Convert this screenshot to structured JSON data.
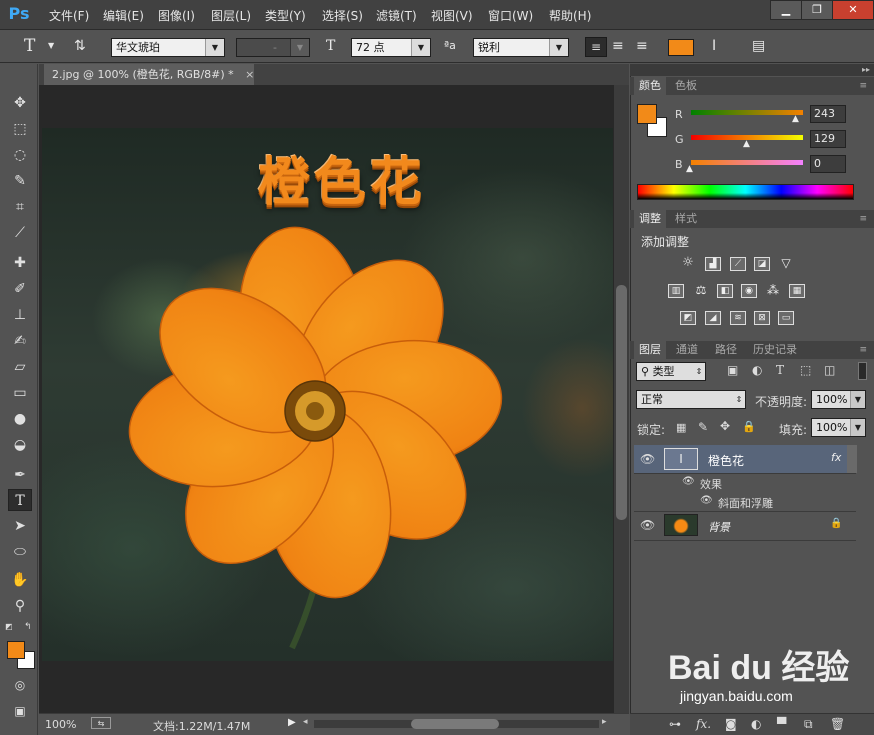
{
  "app": {
    "logo": "Ps"
  },
  "menu": [
    "文件(F)",
    "编辑(E)",
    "图像(I)",
    "图层(L)",
    "类型(Y)",
    "选择(S)",
    "滤镜(T)",
    "视图(V)",
    "窗口(W)",
    "帮助(H)"
  ],
  "window_controls": {
    "minimize": "▁",
    "restore": "❐",
    "close": "✕"
  },
  "options": {
    "tool_glyph": "T",
    "font_family": "华文琥珀",
    "font_style": "-",
    "font_size": "72 点",
    "aa_label": "ªa",
    "anti_alias": "锐利",
    "text_color": "#f28a18"
  },
  "document": {
    "tab_title": "2.jpg @ 100% (橙色花, RGB/8#) *",
    "close_glyph": "×",
    "canvas_text": "橙色花"
  },
  "status": {
    "zoom": "100%",
    "doc_info": "文档:1.22M/1.47M"
  },
  "colors_panel": {
    "tabs": [
      "颜色",
      "色板"
    ],
    "foreground": "#f28a18",
    "background": "#ffffff",
    "channels": [
      {
        "label": "R",
        "value": "243"
      },
      {
        "label": "G",
        "value": "129"
      },
      {
        "label": "B",
        "value": "0"
      }
    ]
  },
  "adjustments_panel": {
    "tabs": [
      "调整",
      "样式"
    ],
    "title": "添加调整"
  },
  "layers_panel": {
    "tabs": [
      "图层",
      "通道",
      "路径",
      "历史记录"
    ],
    "filter_kind": "类型",
    "blend_mode": "正常",
    "opacity_label": "不透明度:",
    "opacity_value": "100%",
    "lock_label": "锁定:",
    "fill_label": "填充:",
    "fill_value": "100%",
    "layers": [
      {
        "name": "橙色花",
        "fx": "fx",
        "effects_label": "效果",
        "effect": "斜面和浮雕"
      },
      {
        "name": "背景"
      }
    ]
  },
  "watermark": {
    "brand": "Bai du 经验",
    "url": "jingyan.baidu.com"
  }
}
